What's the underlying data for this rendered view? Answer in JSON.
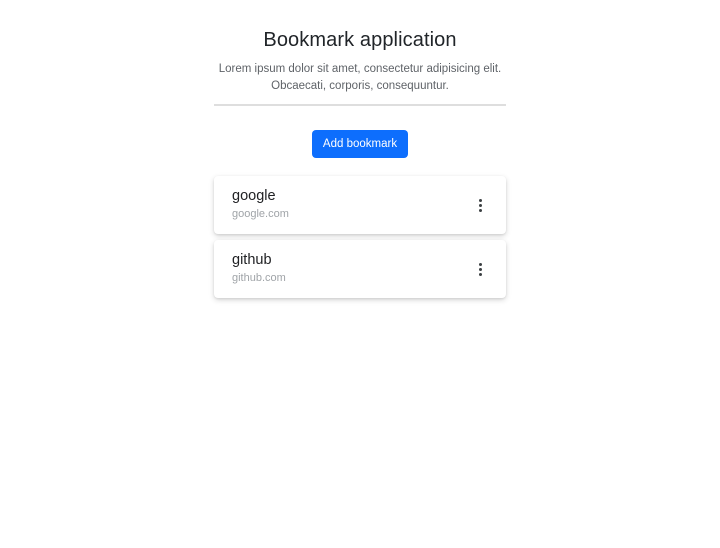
{
  "header": {
    "title": "Bookmark application",
    "subtitle_line1": "Lorem ipsum dolor sit amet, consectetur adipisicing elit.",
    "subtitle_line2": "Obcaecati, corporis, consequuntur."
  },
  "actions": {
    "add_label": "Add bookmark"
  },
  "bookmarks": [
    {
      "name": "google",
      "url": "google.com",
      "menu_icon": "more-vert-icon"
    },
    {
      "name": "github",
      "url": "github.com",
      "menu_icon": "more-vert-icon"
    }
  ],
  "colors": {
    "primary": "#0d6efd",
    "title": "#212529",
    "muted": "#a0a4a8"
  }
}
